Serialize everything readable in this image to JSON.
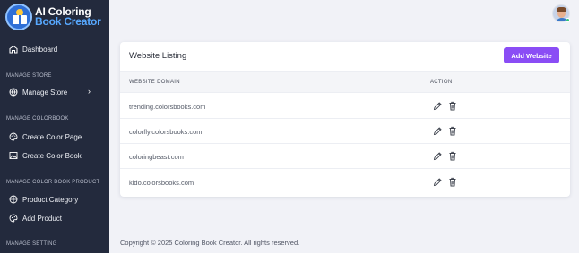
{
  "brand": {
    "line1": "AI Coloring",
    "line2": "Book Creator"
  },
  "sidebar": {
    "dashboard": "Dashboard",
    "sections": [
      "MANAGE STORE",
      "MANAGE COLORBOOK",
      "MANAGE COLOR BOOK PRODUCT",
      "MANAGE SETTING"
    ],
    "items": {
      "manage_store": "Manage Store",
      "create_color_page": "Create Color Page",
      "create_color_book": "Create Color Book",
      "product_category": "Product Category",
      "add_product": "Add Product"
    }
  },
  "card": {
    "title": "Website Listing",
    "add_button": "Add Website",
    "columns": {
      "domain": "WEBSITE DOMAIN",
      "action": "ACTION"
    },
    "rows": [
      {
        "domain": "trending.colorsbooks.com"
      },
      {
        "domain": "colorfly.colorsbooks.com"
      },
      {
        "domain": "coloringbeast.com"
      },
      {
        "domain": "kido.colorsbooks.com"
      }
    ]
  },
  "footer": {
    "text": "Copyright © 2025 Coloring Book Creator. All rights reserved."
  },
  "colors": {
    "sidebar": "#232a3d",
    "accent": "#8a4df5",
    "brand_blue": "#57a8ff"
  }
}
